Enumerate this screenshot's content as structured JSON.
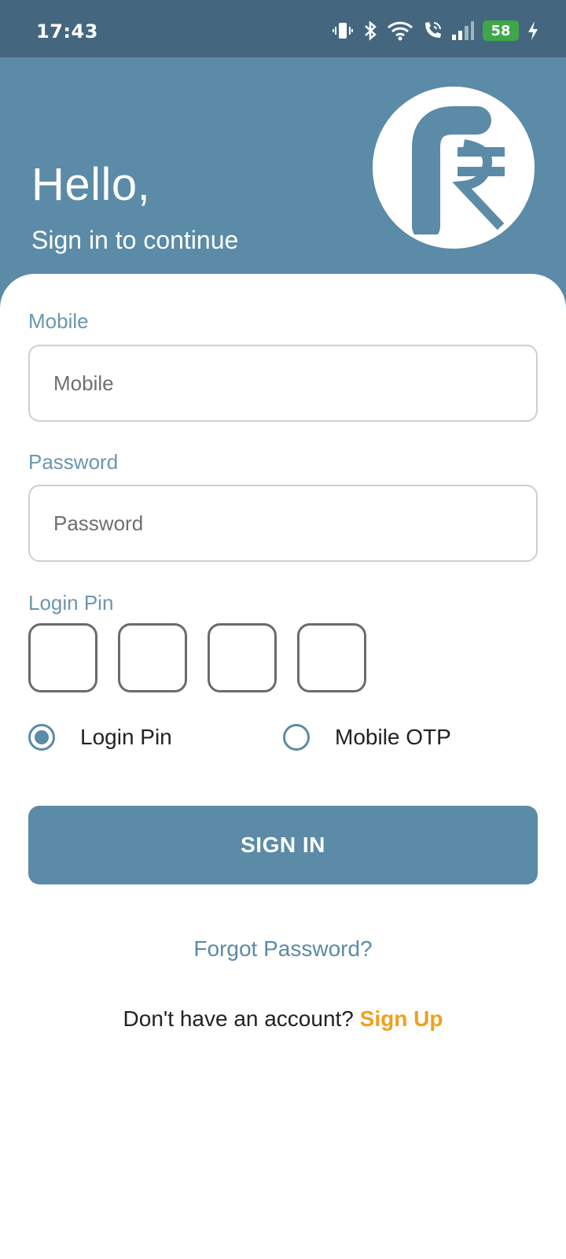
{
  "status_bar": {
    "time": "17:43",
    "battery_level": "58",
    "icons": [
      "vibrate-icon",
      "bluetooth-icon",
      "wifi-icon",
      "wifi-calling-icon",
      "signal-icon",
      "battery-icon",
      "charging-icon"
    ]
  },
  "header": {
    "greeting": "Hello,",
    "subtitle": "Sign in to continue",
    "logo_icon": "rupee-logo-icon"
  },
  "form": {
    "mobile_label": "Mobile",
    "mobile_placeholder": "Mobile",
    "mobile_value": "",
    "password_label": "Password",
    "password_placeholder": "Password",
    "password_value": "",
    "pin_label": "Login Pin",
    "pin_digits": [
      "",
      "",
      "",
      ""
    ],
    "login_method_options": [
      "Login Pin",
      "Mobile OTP"
    ],
    "login_method_selected": "Login Pin",
    "sign_in_label": "SIGN IN",
    "forgot_password_label": "Forgot Password?",
    "signup_prompt": "Don't have an account?",
    "signup_link_label": "Sign Up"
  },
  "colors": {
    "status_bar": "#44677f",
    "primary": "#5b8ba6",
    "label": "#6b97ad",
    "signup_link": "#f0a01b",
    "battery": "#3ea74a"
  }
}
